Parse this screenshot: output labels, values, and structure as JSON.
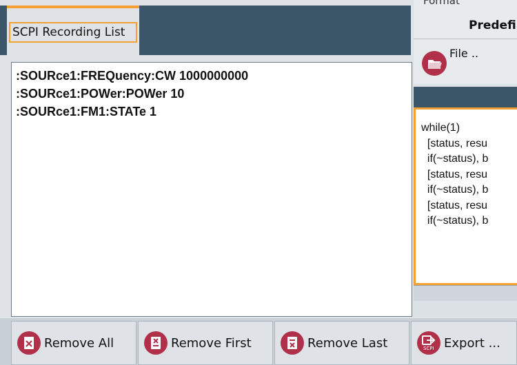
{
  "tab": {
    "label": "SCPI Recording List"
  },
  "recording_list": [
    ":SOURce1:FREQuency:CW 1000000000",
    ":SOURce1:POWer:POWer 10",
    ":SOURce1:FM1:STATe 1"
  ],
  "right_panel": {
    "format_label": "Format",
    "format_value": "Predefi",
    "file_button_label": "File ..",
    "code_lines": [
      "while(1)",
      "  [status, resu",
      "  if(~status), b",
      "",
      "  [status, resu",
      "  if(~status), b",
      "",
      "  [status, resu",
      "  if(~status), b"
    ]
  },
  "toolbar": {
    "remove_all": "Remove All",
    "remove_first": "Remove First",
    "remove_last": "Remove Last",
    "export": "Export ..."
  },
  "colors": {
    "accent": "#f4a032",
    "header": "#3a5668",
    "icon": "#b0304a"
  }
}
